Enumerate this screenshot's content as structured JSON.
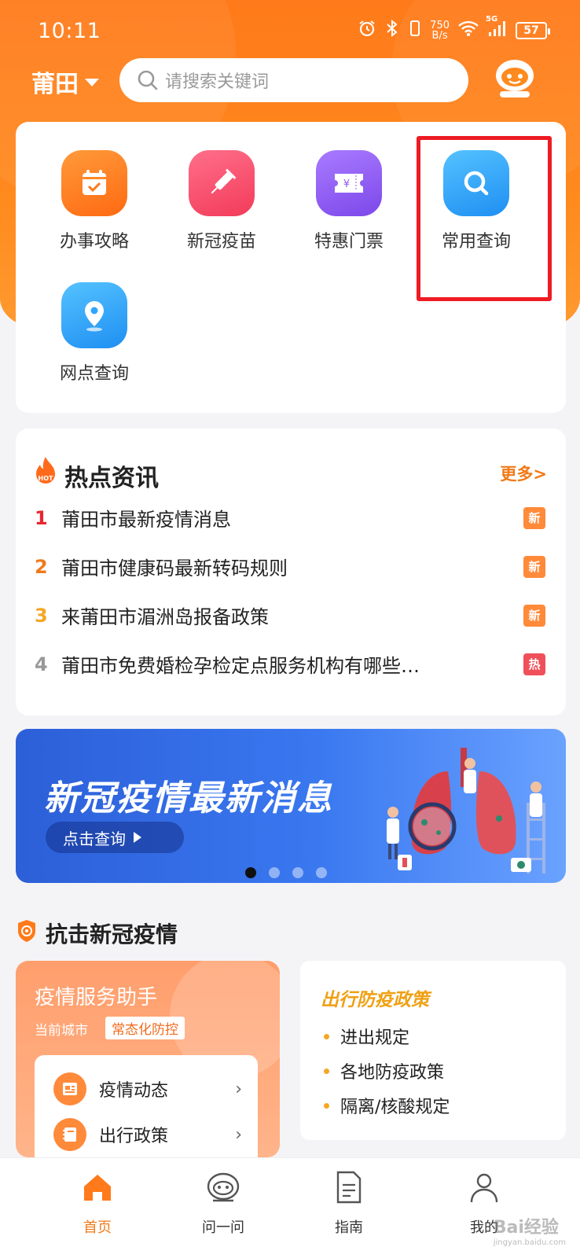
{
  "status_bar": {
    "time": "10:11",
    "net_speed_value": "750",
    "net_speed_unit": "B/s",
    "signal_label": "5G",
    "battery": "57"
  },
  "header": {
    "city": "莆田",
    "search_placeholder": "请搜索关键词"
  },
  "quick_grid": {
    "items": [
      {
        "label": "办事攻略",
        "icon": "calendar-check-icon",
        "color": "#ff7a1a"
      },
      {
        "label": "新冠疫苗",
        "icon": "syringe-icon",
        "color": "#ff4d6d"
      },
      {
        "label": "特惠门票",
        "icon": "ticket-icon",
        "color": "#8f5bf0"
      },
      {
        "label": "常用查询",
        "icon": "search-icon",
        "color": "#2ea6ff"
      },
      {
        "label": "网点查询",
        "icon": "location-pin-icon",
        "color": "#2ea6ff"
      }
    ],
    "highlight_color": "#ee1b24"
  },
  "hot_news": {
    "title": "热点资讯",
    "more": "更多>",
    "items": [
      {
        "num": "1",
        "text": "莆田市最新疫情消息",
        "tag": "新",
        "num_color": "#e8262f",
        "tag_color": "#ff8a3a"
      },
      {
        "num": "2",
        "text": "莆田市健康码最新转码规则",
        "tag": "新",
        "num_color": "#f07a1a",
        "tag_color": "#ff8a3a"
      },
      {
        "num": "3",
        "text": "来莆田市湄洲岛报备政策",
        "tag": "新",
        "num_color": "#f5a623",
        "tag_color": "#ff8a3a"
      },
      {
        "num": "4",
        "text": "莆田市免费婚检孕检定点服务机构有哪些…",
        "tag": "热",
        "num_color": "#999999",
        "tag_color": "#f0505a"
      }
    ]
  },
  "banner": {
    "title": "新冠疫情最新消息",
    "button": "点击查询",
    "active_dot": 0,
    "dot_count": 4
  },
  "covid_section": {
    "title": "抗击新冠疫情",
    "assistant": {
      "title": "疫情服务助手",
      "city_label": "当前城市",
      "status_badge": "常态化防控",
      "rows": [
        {
          "label": "疫情动态",
          "icon": "news-icon"
        },
        {
          "label": "出行政策",
          "icon": "notebook-icon"
        }
      ]
    },
    "policy": {
      "title": "出行防疫政策",
      "items": [
        "进出规定",
        "各地防疫政策",
        "隔离/核酸规定"
      ]
    }
  },
  "tab_bar": {
    "tabs": [
      {
        "label": "首页",
        "icon": "home-icon",
        "active": true
      },
      {
        "label": "问一问",
        "icon": "robot-icon",
        "active": false
      },
      {
        "label": "指南",
        "icon": "document-icon",
        "active": false
      },
      {
        "label": "我的",
        "icon": "user-icon",
        "active": false
      }
    ]
  },
  "watermark": {
    "brand": "Bai",
    "brand_suffix": "经验",
    "url": "jingyan.baidu.com"
  }
}
